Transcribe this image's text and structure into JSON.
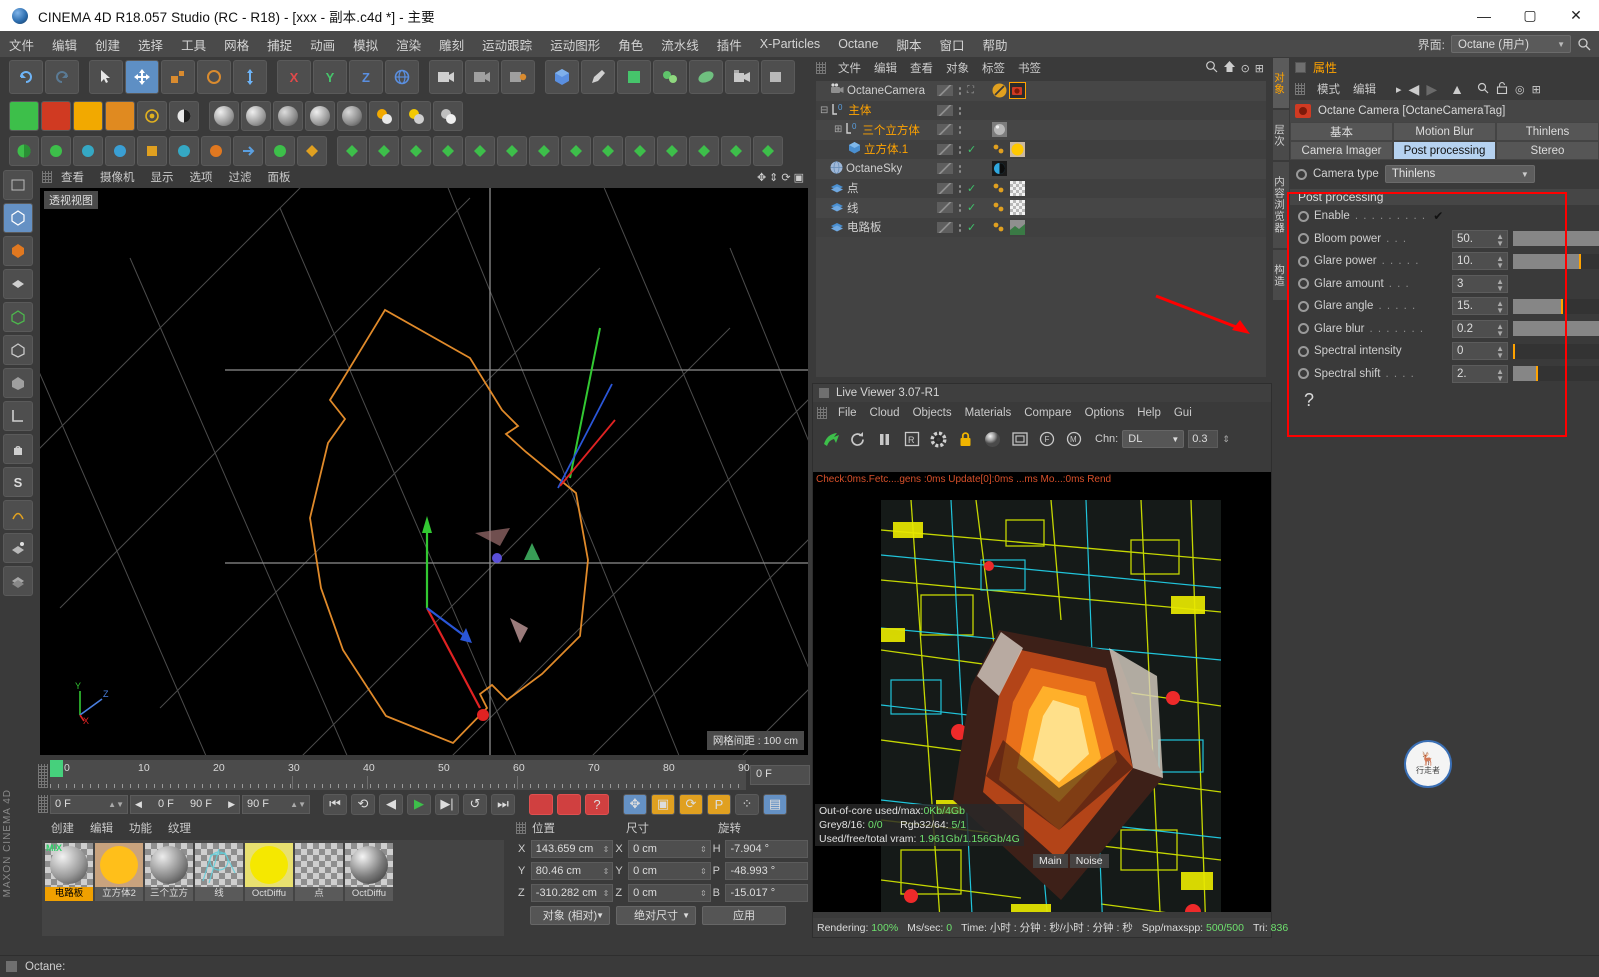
{
  "titlebar": {
    "title": "CINEMA 4D R18.057 Studio (RC - R18) - [xxx - 副本.c4d *] - 主要",
    "minimize": "—",
    "maximize": "▢",
    "close": "✕"
  },
  "menubar": {
    "items": [
      "文件",
      "编辑",
      "创建",
      "选择",
      "工具",
      "网格",
      "捕捉",
      "动画",
      "模拟",
      "渲染",
      "雕刻",
      "运动跟踪",
      "运动图形",
      "角色",
      "流水线",
      "插件",
      "X-Particles",
      "Octane",
      "脚本",
      "窗口",
      "帮助"
    ],
    "interface_label": "界面:",
    "interface_value": "Octane (用户)"
  },
  "viewport": {
    "menu": [
      "查看",
      "摄像机",
      "显示",
      "选项",
      "过滤",
      "面板"
    ],
    "label": "透视视图",
    "grid_info": "网格间距 : 100 cm",
    "axis": {
      "x": "X",
      "y": "Y",
      "z": "Z"
    }
  },
  "timeline": {
    "ticks": [
      "0",
      "10",
      "20",
      "30",
      "40",
      "50",
      "60",
      "70",
      "80",
      "90"
    ],
    "current_frame": "0 F",
    "start_field": "0 F",
    "range_start": "0 F",
    "range_end": "90 F",
    "end_field": "90 F"
  },
  "materials": {
    "menu": [
      "创建",
      "编辑",
      "功能",
      "纹理"
    ],
    "items": [
      {
        "name": "电路板",
        "selected": true,
        "mix": "MIX",
        "color": "#8a8a8a",
        "kind": "ball"
      },
      {
        "name": "立方体2",
        "selected": false,
        "color": "#ffbf1a",
        "kind": "flat"
      },
      {
        "name": "三个立方",
        "selected": false,
        "color": "#7d7d7d",
        "kind": "ball"
      },
      {
        "name": "线",
        "selected": false,
        "color": "#6fd5dd",
        "kind": "checker"
      },
      {
        "name": "OctDiffu",
        "selected": false,
        "color": "#f5e800",
        "kind": "flat"
      },
      {
        "name": "点",
        "selected": false,
        "color": "#9a9a9a",
        "kind": "checker"
      },
      {
        "name": "OctDiffu",
        "selected": false,
        "color": "#7d7d7d",
        "kind": "ball"
      }
    ]
  },
  "coordinates": {
    "headers": [
      "位置",
      "尺寸",
      "旋转"
    ],
    "rows": [
      {
        "l1": "X",
        "v1": "143.659 cm",
        "l2": "X",
        "v2": "0 cm",
        "l3": "H",
        "v3": "-7.904 °"
      },
      {
        "l1": "Y",
        "v1": "80.46 cm",
        "l2": "Y",
        "v2": "0 cm",
        "l3": "P",
        "v3": "-48.993 °"
      },
      {
        "l1": "Z",
        "v1": "-310.282 cm",
        "l2": "Z",
        "v2": "0 cm",
        "l3": "B",
        "v3": "-15.017 °"
      }
    ],
    "mode_left": "对象 (相对)",
    "mode_mid": "绝对尺寸",
    "apply": "应用"
  },
  "object_manager": {
    "menu": [
      "文件",
      "编辑",
      "查看",
      "对象",
      "标签",
      "书签"
    ],
    "rows": [
      {
        "name": "OctaneCamera",
        "indent": 10,
        "color": "#cfcfcf",
        "icon": "camera-icon",
        "check": false,
        "tags": [
          "octane-disc",
          "camera-tag"
        ]
      },
      {
        "name": "主体",
        "indent": 2,
        "color": "#ffa300",
        "icon": "null-icon",
        "check": false,
        "tags": []
      },
      {
        "name": "三个立方体",
        "indent": 16,
        "color": "#ffa300",
        "icon": "null-icon",
        "check": false,
        "tags": [
          "material-grey"
        ]
      },
      {
        "name": "立方体.1",
        "indent": 30,
        "color": "#ffa300",
        "icon": "cube-icon",
        "check": true,
        "tags": [
          "material-yellow"
        ]
      },
      {
        "name": "OctaneSky",
        "indent": 10,
        "color": "#cfcfcf",
        "icon": "sphere-icon",
        "check": false,
        "tags": [
          "sky-tag"
        ]
      },
      {
        "name": "点",
        "indent": 10,
        "color": "#cfcfcf",
        "icon": "layer-icon",
        "check": true,
        "tags": [
          "material-checker"
        ]
      },
      {
        "name": "线",
        "indent": 10,
        "color": "#cfcfcf",
        "icon": "layer-icon",
        "check": true,
        "tags": [
          "material-checker2"
        ]
      },
      {
        "name": "电路板",
        "indent": 10,
        "color": "#cfcfcf",
        "icon": "layer-icon",
        "check": true,
        "tags": [
          "material-board"
        ]
      }
    ]
  },
  "live_viewer": {
    "title": "Live Viewer 3.07-R1",
    "menu": [
      "File",
      "Cloud",
      "Objects",
      "Materials",
      "Compare",
      "Options",
      "Help",
      "Gui"
    ],
    "chn_label": "Chn:",
    "chn_value": "DL",
    "num_value": "0.3",
    "check_text": "Check:0ms.Fetc....gens  :0ms  Update[0]:0ms    ...ms  Mo...:0ms  Rend",
    "stats": [
      "Out-of-core used/max:0Kb/4Gb",
      "Grey8/16: 0/0          Rgb32/64: 5/1",
      "Used/free/total vram: 1.961Gb/1.156Gb/4G"
    ],
    "overlay_tabs": [
      "Main",
      "Noise"
    ],
    "status": [
      "Rendering: 100%",
      "Ms/sec: 0",
      "Time: 小时 : 分钟 : 秒/小时 : 分钟 : 秒",
      "Spp/maxspp: 500/500",
      "Tri: 836"
    ]
  },
  "vtabs": [
    {
      "label": "对象",
      "active": true
    },
    {
      "label": "层次",
      "active": false
    },
    {
      "label": "内容浏览器",
      "active": false
    },
    {
      "label": "构造",
      "active": false
    }
  ],
  "attributes": {
    "panel_title": "属性",
    "menu": [
      "模式",
      "编辑"
    ],
    "object_title": "Octane Camera [OctaneCameraTag]",
    "tabs_row1": [
      {
        "label": "基本",
        "active": false
      },
      {
        "label": "Motion Blur",
        "active": false
      },
      {
        "label": "Thinlens",
        "active": false
      }
    ],
    "tabs_row2": [
      {
        "label": "Camera Imager",
        "active": false
      },
      {
        "label": "Post processing",
        "active": true
      },
      {
        "label": "Stereo",
        "active": false
      }
    ],
    "camera_type_label": "Camera type",
    "camera_type_value": "Thinlens",
    "section_title": "Post processing",
    "params": [
      {
        "name": "Enable",
        "dots": ". . . . . . . . .",
        "type": "check",
        "value": "✔"
      },
      {
        "name": "Bloom power",
        "dots": ". . .",
        "type": "num",
        "value": "50.",
        "fill": 100,
        "mark": -1
      },
      {
        "name": "Glare power",
        "dots": ". . . . .",
        "type": "num",
        "value": "10.",
        "fill": 78,
        "mark": 78
      },
      {
        "name": "Glare amount",
        "dots": ". . .",
        "type": "num",
        "value": "3",
        "fill": 0,
        "mark": -1,
        "noslider": true
      },
      {
        "name": "Glare angle",
        "dots": ". . . . .",
        "type": "num",
        "value": "15.",
        "fill": 57,
        "mark": 57
      },
      {
        "name": "Glare blur",
        "dots": ". . . . . . .",
        "type": "num",
        "value": "0.2",
        "fill": 100,
        "mark": -1
      },
      {
        "name": "Spectral intensity",
        "dots": "",
        "type": "num",
        "value": "0",
        "fill": 0,
        "mark": 1
      },
      {
        "name": "Spectral shift",
        "dots": ". . . .",
        "type": "num",
        "value": "2.",
        "fill": 27,
        "mark": 27
      }
    ],
    "help_glyph": "?"
  },
  "deer_button": {
    "line1": "🦌",
    "line2": "行走者"
  },
  "statusbar": {
    "text": "Octane:"
  },
  "colors": {
    "accent_orange": "#ffa300",
    "annotation_red": "#ff0000",
    "tab_active": "#b6d2f0",
    "check_green": "#3ec46b"
  }
}
